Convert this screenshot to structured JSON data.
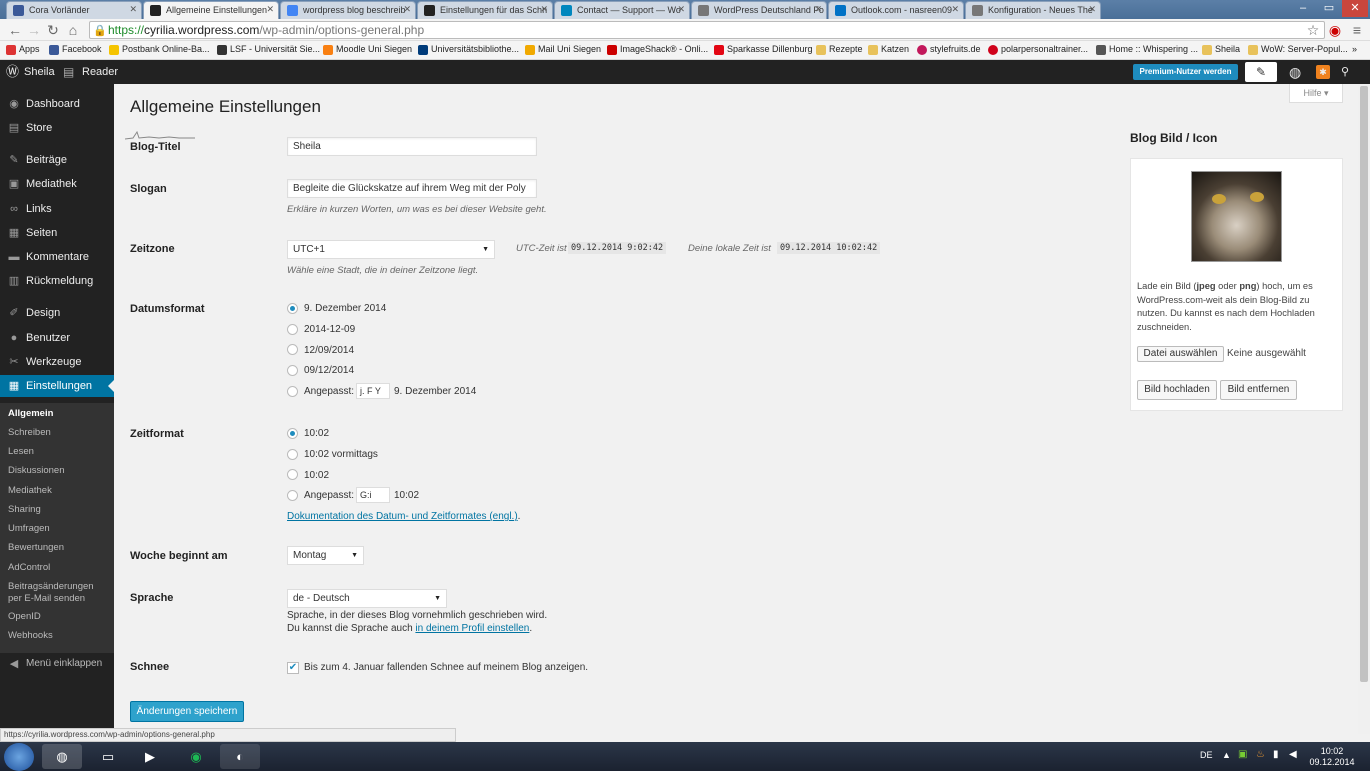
{
  "browser": {
    "tabs": [
      {
        "label": "Cora Vorländer",
        "color": "#3b5998"
      },
      {
        "label": "Allgemeine Einstellungen",
        "color": "#222222"
      },
      {
        "label": "wordpress blog beschreib",
        "color": "#4285f4"
      },
      {
        "label": "Einstellungen für das Schn",
        "color": "#222222"
      },
      {
        "label": "Contact — Support — Wo",
        "color": "#0087be"
      },
      {
        "label": "WordPress Deutschland Fo",
        "color": "#777777"
      },
      {
        "label": "Outlook.com - nasreen09",
        "color": "#0072c6"
      },
      {
        "label": "Konfiguration - Neues The",
        "color": "#777777"
      }
    ],
    "url": {
      "scheme": "https://",
      "host": "cyrilia.wordpress.com",
      "path": "/wp-admin/options-general.php"
    },
    "bookmarks": [
      {
        "label": "Apps",
        "color": "#d33"
      },
      {
        "label": "Facebook",
        "color": "#3b5998"
      },
      {
        "label": "Postbank Online-Ba...",
        "color": "#f5c400"
      },
      {
        "label": "LSF - Universität Sie...",
        "color": "#333"
      },
      {
        "label": "Moodle Uni Siegen",
        "color": "#f98012"
      },
      {
        "label": "Universitätsbibliothe...",
        "color": "#003b7a"
      },
      {
        "label": "Mail Uni Siegen",
        "color": "#f1a900"
      },
      {
        "label": "ImageShack® - Onli...",
        "color": "#c00"
      },
      {
        "label": "Sparkasse Dillenburg",
        "color": "#e30613"
      },
      {
        "label": "Rezepte",
        "color": "#e8c25b"
      },
      {
        "label": "Katzen",
        "color": "#e8c25b"
      },
      {
        "label": "stylefruits.de",
        "color": "#c2185b"
      },
      {
        "label": "polarpersonaltrainer...",
        "color": "#d0021b"
      },
      {
        "label": "Home :: Whispering ...",
        "color": "#555"
      },
      {
        "label": "Sheila",
        "color": "#e8c25b"
      },
      {
        "label": "WoW: Server-Popul...",
        "color": "#e8c25b"
      }
    ],
    "status_url": "https://cyrilia.wordpress.com/wp-admin/options-general.php"
  },
  "adminbar": {
    "site_name": "Sheila",
    "reader": "Reader",
    "premium_label": "Premium-Nutzer werden"
  },
  "sidebar": {
    "menu": [
      {
        "label": "Dashboard",
        "icon": "dashboard-icon",
        "glyph": "◉"
      },
      {
        "label": "Store",
        "icon": "cart-icon",
        "glyph": "▤"
      },
      {
        "label": "Beiträge",
        "icon": "pin-icon",
        "glyph": "✎"
      },
      {
        "label": "Mediathek",
        "icon": "media-icon",
        "glyph": "▣"
      },
      {
        "label": "Links",
        "icon": "link-icon",
        "glyph": "∞"
      },
      {
        "label": "Seiten",
        "icon": "pages-icon",
        "glyph": "▦"
      },
      {
        "label": "Kommentare",
        "icon": "comments-icon",
        "glyph": "▬"
      },
      {
        "label": "Rückmeldung",
        "icon": "feedback-icon",
        "glyph": "▥"
      },
      {
        "label": "Design",
        "icon": "brush-icon",
        "glyph": "✐"
      },
      {
        "label": "Benutzer",
        "icon": "users-icon",
        "glyph": "●"
      },
      {
        "label": "Werkzeuge",
        "icon": "tools-icon",
        "glyph": "✂"
      },
      {
        "label": "Einstellungen",
        "icon": "settings-icon",
        "glyph": "▦"
      }
    ],
    "submenu": [
      "Allgemein",
      "Schreiben",
      "Lesen",
      "Diskussionen",
      "Mediathek",
      "Sharing",
      "Umfragen",
      "Bewertungen",
      "AdControl",
      "Beitragsänderungen per E-Mail senden",
      "OpenID",
      "Webhooks"
    ],
    "collapse": "Menü einklappen"
  },
  "page": {
    "title": "Allgemeine Einstellungen",
    "help": "Hilfe",
    "blog_title_label": "Blog-Titel",
    "blog_title_value": "Sheila",
    "slogan_label": "Slogan",
    "slogan_value": "Begleite die Glückskatze auf ihrem Weg mit der Poly",
    "slogan_desc": "Erkläre in kurzen Worten, um was es bei dieser Website geht.",
    "timezone_label": "Zeitzone",
    "timezone_value": "UTC+1",
    "utc_label": "UTC-Zeit ist",
    "utc_value": "09.12.2014 9:02:42",
    "local_label": "Deine lokale Zeit ist",
    "local_value": "09.12.2014 10:02:42",
    "timezone_desc": "Wähle eine Stadt, die in deiner Zeitzone liegt.",
    "dateformat_label": "Datumsformat",
    "date_options": [
      "9. Dezember 2014",
      "2014-12-09",
      "12/09/2014",
      "09/12/2014"
    ],
    "custom_label": "Angepasst:",
    "date_custom_value": "j. F Y",
    "date_custom_preview": "9. Dezember 2014",
    "timeformat_label": "Zeitformat",
    "time_options": [
      "10:02",
      "10:02 vormittags",
      "10:02"
    ],
    "time_custom_value": "G:i",
    "time_custom_preview": "10:02",
    "doc_link": "Dokumentation des Datum- und Zeitformates (engl.)",
    "doc_link_suffix": ".",
    "week_label": "Woche beginnt am",
    "week_value": "Montag",
    "language_label": "Sprache",
    "language_value": "de - Deutsch",
    "language_desc1": "Sprache, in der dieses Blog vornehmlich geschrieben wird.",
    "language_desc2_prefix": "Du kannst die Sprache auch",
    "language_link": "in deinem Profil einstellen",
    "language_desc2_suffix": ".",
    "snow_label": "Schnee",
    "snow_text": "Bis zum 4. Januar fallenden Schnee auf meinem Blog anzeigen.",
    "save_label": "Änderungen speichern"
  },
  "widget": {
    "title": "Blog Bild / Icon",
    "desc_1": "Lade ein Bild (",
    "desc_jpeg": "jpeg",
    "desc_2": " oder ",
    "desc_png": "png",
    "desc_3": ") hoch, um es WordPress.com-weit als dein Blog-Bild zu nutzen. Du kannst es nach dem Hochladen zuschneiden.",
    "choose_file": "Datei auswählen",
    "no_file": "Keine ausgewählt",
    "upload": "Bild hochladen",
    "remove": "Bild entfernen"
  },
  "taskbar": {
    "lang": "DE",
    "time": "10:02",
    "date": "09.12.2014"
  }
}
